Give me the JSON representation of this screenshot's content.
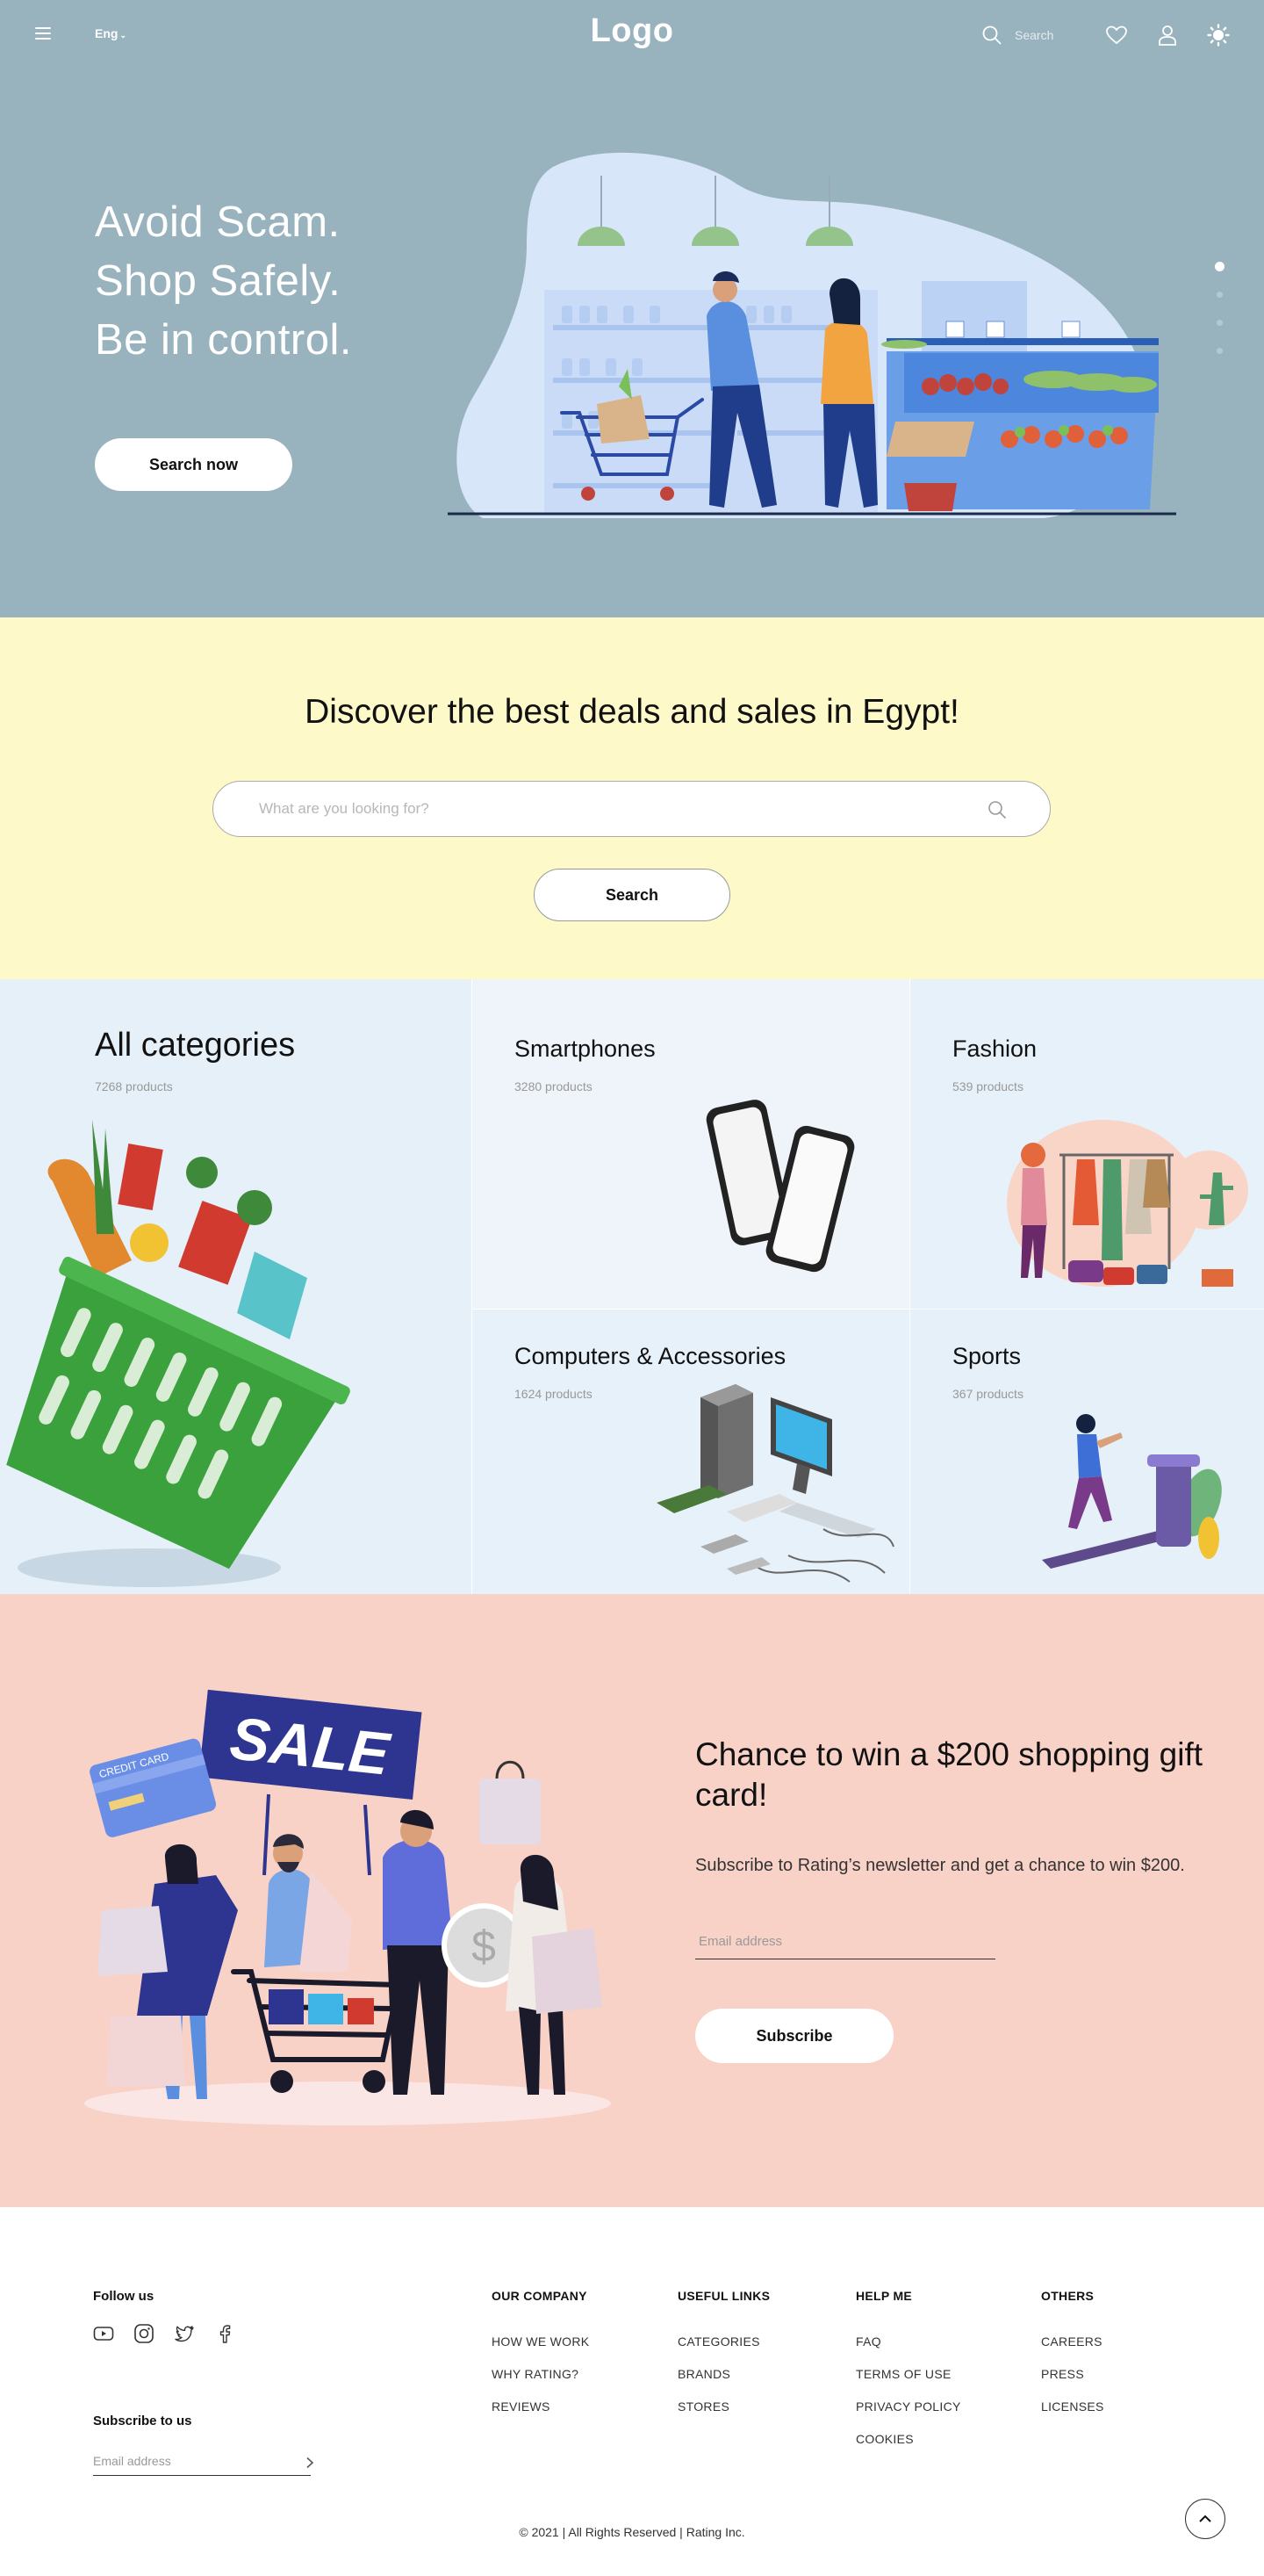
{
  "header": {
    "language": "Eng",
    "logo": "Logo",
    "search_placeholder": "Search"
  },
  "hero": {
    "line1": "Avoid Scam.",
    "line2": "Shop Safely.",
    "line3": "Be in control.",
    "cta": "Search now",
    "slides_total": 4,
    "active_slide": 1
  },
  "deals": {
    "title": "Discover the best deals and sales in Egypt!",
    "search_placeholder": "What are you looking for?",
    "search_button": "Search"
  },
  "categories": [
    {
      "name": "All categories",
      "count": "7268 products"
    },
    {
      "name": "Smartphones",
      "count": "3280 products"
    },
    {
      "name": "Fashion",
      "count": "539 products"
    },
    {
      "name": "Computers & Accessories",
      "count": "1624 products"
    },
    {
      "name": "Sports",
      "count": "367 products"
    }
  ],
  "promo": {
    "title": "Chance to win a $200 shopping gift card!",
    "text": "Subscribe to Rating’s newsletter and get a chance to win $200.",
    "email_placeholder": "Email address",
    "button": "Subscribe",
    "sign_text": "SALE",
    "card_text": "CREDIT CARD"
  },
  "footer": {
    "follow_title": "Follow us",
    "socials": [
      "youtube-icon",
      "instagram-icon",
      "twitter-icon",
      "facebook-icon"
    ],
    "subscribe_title": "Subscribe to us",
    "subscribe_placeholder": "Email address",
    "columns": [
      {
        "title": "OUR COMPANY",
        "links": [
          "HOW WE WORK",
          "WHY RATING?",
          "REVIEWS"
        ]
      },
      {
        "title": "USEFUL LINKS",
        "links": [
          "CATEGORIES",
          "BRANDS",
          "STORES"
        ]
      },
      {
        "title": "HELP ME",
        "links": [
          "FAQ",
          "TERMS OF USE",
          "PRIVACY POLICY",
          "COOKIES"
        ]
      },
      {
        "title": "OTHERS",
        "links": [
          "CAREERS",
          "PRESS",
          "LICENSES"
        ]
      }
    ],
    "copyright": "© 2021 | All Rights Reserved | Rating Inc."
  },
  "colors": {
    "hero_bg": "#98b3bd",
    "deals_bg": "#fef9c8",
    "categories_bg": "#e7f1f9",
    "promo_bg": "#f9d2c7"
  }
}
